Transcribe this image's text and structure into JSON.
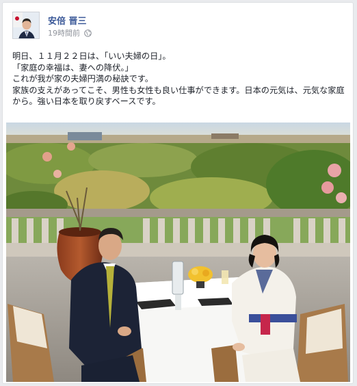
{
  "post": {
    "author": "安倍 晋三",
    "timestamp": "19時間前",
    "audience_icon": "globe-icon",
    "text_lines": [
      "明日、１１月２２日は、「いい夫婦の日」。",
      "「家庭の幸福は、妻への降伏。」",
      "これが我が家の夫婦円満の秘訣です。",
      "家族の支えがあってこそ、男性も女性も良い仕事ができます。日本の元気は、元気な家庭から。強い日本を取り戻すベースです。"
    ],
    "photo_icon": "photo-of-couple-on-terrace"
  },
  "colors": {
    "author_link": "#3b5998",
    "meta_text": "#90949c",
    "body_text": "#1d2129"
  }
}
